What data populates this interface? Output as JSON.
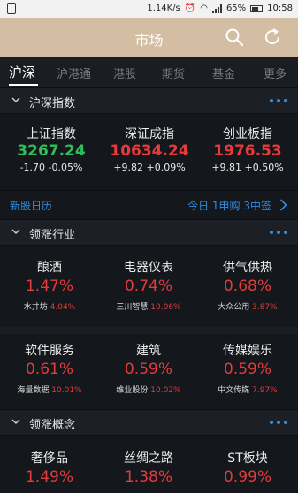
{
  "status_bar": {
    "speed": "1.14K/s",
    "battery": "65%",
    "time": "10:58"
  },
  "header": {
    "title": "市场",
    "icons": [
      "search-icon",
      "refresh-icon"
    ]
  },
  "tabs": [
    "沪深",
    "沪港通",
    "港股",
    "期货",
    "基金",
    "更多"
  ],
  "indices_section": {
    "title": "沪深指数",
    "items": [
      {
        "name": "上证指数",
        "value": "3267.24",
        "change": "-1.70 -0.05%",
        "color": "#2fbf5a"
      },
      {
        "name": "深证成指",
        "value": "10634.24",
        "change": "+9.82 +0.09%",
        "color": "#e43b3b"
      },
      {
        "name": "创业板指",
        "value": "1976.53",
        "change": "+9.81 +0.50%",
        "color": "#e43b3b"
      }
    ]
  },
  "ipo": {
    "label": "新股日历",
    "info": "今日 1申购 3中签"
  },
  "industry_section": {
    "title": "领涨行业",
    "items": [
      {
        "name": "酿酒",
        "pct": "1.47%",
        "stock": "水井坊",
        "stock_pct": "4.04%"
      },
      {
        "name": "电器仪表",
        "pct": "0.74%",
        "stock": "三川智慧",
        "stock_pct": "10.06%"
      },
      {
        "name": "供气供热",
        "pct": "0.68%",
        "stock": "大众公用",
        "stock_pct": "3.87%"
      },
      {
        "name": "软件服务",
        "pct": "0.61%",
        "stock": "海量数据",
        "stock_pct": "10.01%"
      },
      {
        "name": "建筑",
        "pct": "0.59%",
        "stock": "维业股份",
        "stock_pct": "10.02%"
      },
      {
        "name": "传媒娱乐",
        "pct": "0.59%",
        "stock": "中文传媒",
        "stock_pct": "7.97%"
      }
    ]
  },
  "concept_section": {
    "title": "领涨概念",
    "items": [
      {
        "name": "奢侈品",
        "pct": "1.49%"
      },
      {
        "name": "丝绸之路",
        "pct": "1.38%"
      },
      {
        "name": "ST板块",
        "pct": "0.99%"
      }
    ]
  },
  "colors": {
    "header_bg": "#d3bea3",
    "accent_blue": "#2f8ce0",
    "up_red": "#e43b3b",
    "down_green": "#2fbf5a",
    "background": "#14171c"
  }
}
